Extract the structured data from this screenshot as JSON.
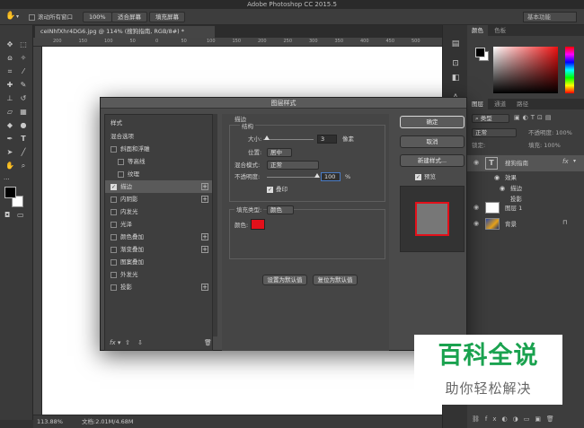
{
  "app": {
    "title": "Adobe Photoshop CC 2015.5"
  },
  "options_bar": {
    "scroll_all_label": "滚动所有窗口",
    "zoom_100": "100%",
    "fit_screen": "适合屏幕",
    "fill_screen": "填充屏幕",
    "workspace": "基本功能"
  },
  "document": {
    "tab_title": "ceINhfXhr4DG6.jpg @ 114% (搜狗指南, RGB/8#) *",
    "ruler_marks": [
      "200",
      "150",
      "100",
      "50",
      "0",
      "50",
      "100",
      "150",
      "200",
      "250",
      "300",
      "350",
      "400",
      "450",
      "500"
    ],
    "zoom_status": "113.88%",
    "doc_status": "文档:2.01M/4.68M"
  },
  "dialog": {
    "title": "图层样式",
    "styles_header": "样式",
    "blend_options": "混合选项",
    "items": [
      {
        "label": "斜面和浮雕",
        "checked": false,
        "indent": false,
        "plus": false
      },
      {
        "label": "等高线",
        "checked": false,
        "indent": true,
        "plus": false
      },
      {
        "label": "纹理",
        "checked": false,
        "indent": true,
        "plus": false
      },
      {
        "label": "描边",
        "checked": true,
        "indent": false,
        "plus": true,
        "selected": true
      },
      {
        "label": "内阴影",
        "checked": false,
        "indent": false,
        "plus": true
      },
      {
        "label": "内发光",
        "checked": false,
        "indent": false,
        "plus": false
      },
      {
        "label": "光泽",
        "checked": false,
        "indent": false,
        "plus": false
      },
      {
        "label": "颜色叠加",
        "checked": false,
        "indent": false,
        "plus": true
      },
      {
        "label": "渐变叠加",
        "checked": false,
        "indent": false,
        "plus": true
      },
      {
        "label": "图案叠加",
        "checked": false,
        "indent": false,
        "plus": false
      },
      {
        "label": "外发光",
        "checked": false,
        "indent": false,
        "plus": false
      },
      {
        "label": "投影",
        "checked": false,
        "indent": false,
        "plus": true
      }
    ],
    "stroke": {
      "section_title": "描边",
      "structure_title": "结构",
      "size_label": "大小:",
      "size_value": "3",
      "size_unit": "像素",
      "position_label": "位置:",
      "position_value": "居中",
      "blend_label": "混合模式:",
      "blend_value": "正常",
      "opacity_label": "不透明度:",
      "opacity_value": "100",
      "opacity_unit": "%",
      "overprint_label": "叠印",
      "fill_type_label": "填充类型:",
      "fill_type_value": "颜色",
      "color_label": "颜色:",
      "stroke_color": "#e3101a"
    },
    "set_default": "设置为默认值",
    "reset_default": "复位为默认值",
    "ok": "确定",
    "cancel": "取消",
    "new_style": "新建样式...",
    "preview_label": "预览",
    "fx_label": "fx"
  },
  "color_panel": {
    "tab_color": "颜色",
    "tab_swatches": "色板"
  },
  "layers_panel": {
    "tab_layers": "图层",
    "tab_channels": "通道",
    "tab_paths": "路径",
    "kind_label": "类型",
    "blend_mode": "正常",
    "opacity_label": "不透明度: 100%",
    "lock_label": "锁定:",
    "fill_label": "填充: 100%",
    "layers": [
      {
        "name": "搜狗指南",
        "type": "text"
      },
      {
        "name": "效果",
        "type": "effects-group"
      },
      {
        "name": "描边",
        "type": "effect"
      },
      {
        "name": "投影",
        "type": "effect"
      },
      {
        "name": "图层 1",
        "type": "pixel"
      },
      {
        "name": "背景",
        "type": "background"
      }
    ]
  },
  "watermark": {
    "title": "百科全说",
    "subtitle": "助你轻松解决"
  }
}
